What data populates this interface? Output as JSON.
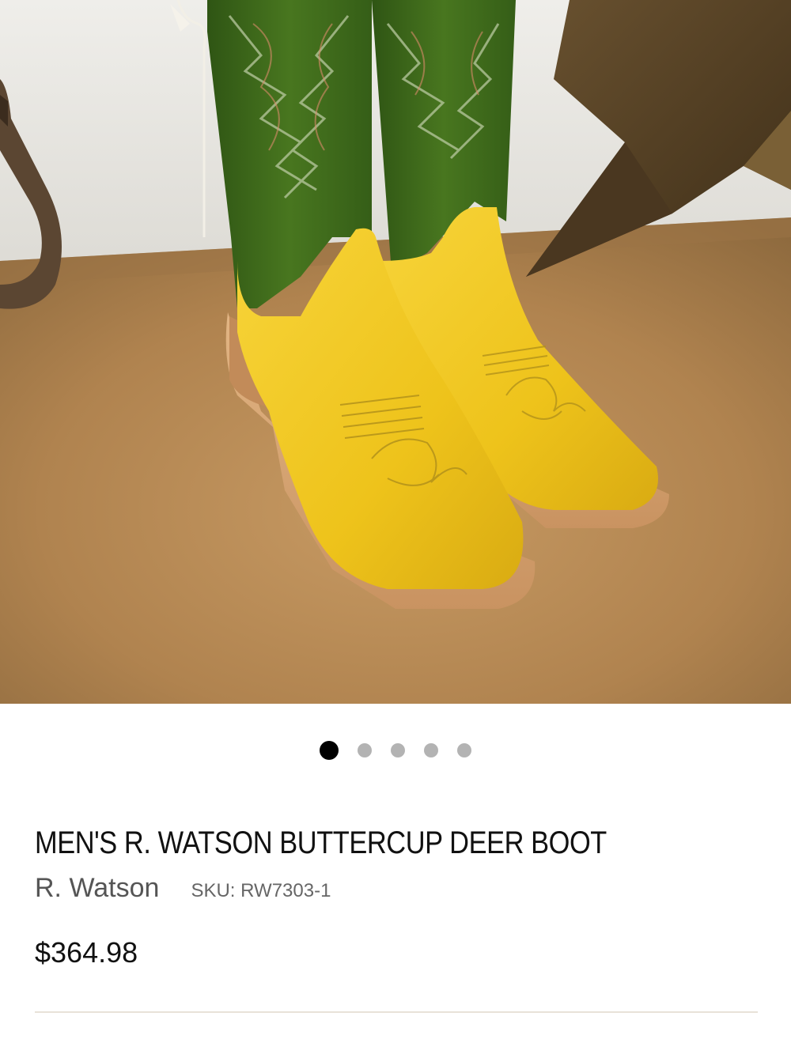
{
  "gallery": {
    "image_alt": "Yellow and green cowboy boots",
    "slide_count": 5,
    "active_index": 0
  },
  "product": {
    "title": "MEN'S R. WATSON BUTTERCUP DEER BOOT",
    "brand": "R. Watson",
    "sku": "SKU: RW7303-1",
    "price": "$364.98"
  },
  "colors": {
    "boot_vamp": "#f0c419",
    "boot_shaft": "#3e6a1c",
    "dot_active": "#000000",
    "dot_inactive": "#b3b3b3"
  }
}
